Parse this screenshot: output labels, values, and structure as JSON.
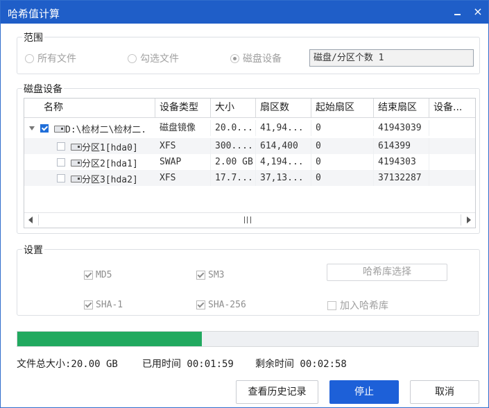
{
  "window": {
    "title": "哈希值计算",
    "close_glyph": "×"
  },
  "scope": {
    "label": "范围",
    "options": [
      {
        "label": "所有文件",
        "selected": false
      },
      {
        "label": "勾选文件",
        "selected": false
      },
      {
        "label": "磁盘设备",
        "selected": true
      }
    ],
    "count_box": "磁盘/分区个数 1"
  },
  "disks": {
    "label": "磁盘设备",
    "columns": [
      "名称",
      "设备类型",
      "大小",
      "扇区数",
      "起始扇区",
      "结束扇区",
      "设备..."
    ],
    "rows": [
      {
        "name": "D:\\检材二\\检材二.",
        "checked": true,
        "type": "磁盘镜像",
        "size": "20.0...",
        "sectors": "41,94...",
        "start": "0",
        "end": "41943039",
        "device": ""
      },
      {
        "name": "分区1[hda0]",
        "checked": false,
        "type": "XFS",
        "size": "300....",
        "sectors": "614,400",
        "start": "0",
        "end": "614399",
        "device": ""
      },
      {
        "name": "分区2[hda1]",
        "checked": false,
        "type": "SWAP",
        "size": "2.00 GB",
        "sectors": "4,194...",
        "start": "0",
        "end": "4194303",
        "device": ""
      },
      {
        "name": "分区3[hda2]",
        "checked": false,
        "type": "XFS",
        "size": "17.7...",
        "sectors": "37,13...",
        "start": "0",
        "end": "37132287",
        "device": ""
      }
    ]
  },
  "settings": {
    "label": "设置",
    "algorithms": [
      {
        "label": "MD5",
        "checked": true
      },
      {
        "label": "SM3",
        "checked": true
      },
      {
        "label": "SHA-1",
        "checked": true
      },
      {
        "label": "SHA-256",
        "checked": true
      }
    ],
    "hash_lib_button": "哈希库选择",
    "add_to_lib": {
      "label": "加入哈希库",
      "checked": false
    }
  },
  "progress": {
    "fraction": 0.4
  },
  "status": {
    "total_size": "文件总大小:20.00 GB",
    "elapsed": "已用时间 00:01:59",
    "remaining": "剩余时间 00:02:58"
  },
  "buttons": {
    "history": "查看历史记录",
    "stop": "停止",
    "cancel": "取消"
  },
  "colors": {
    "titlebar": "#1f5ec8",
    "progress_fill": "#21a95f",
    "primary_button": "#1d60d8"
  }
}
